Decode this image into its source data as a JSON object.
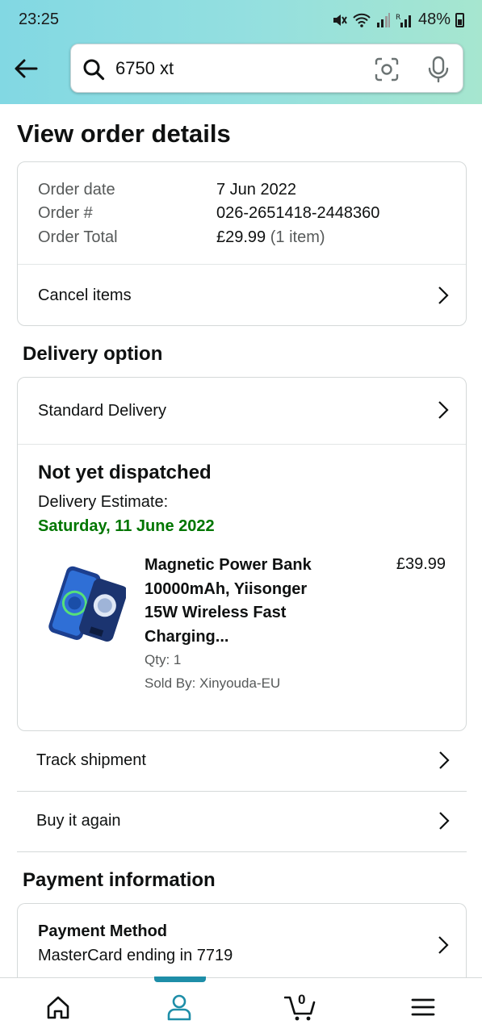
{
  "status_bar": {
    "time": "23:25",
    "battery": "48%"
  },
  "search": {
    "query": "6750 xt"
  },
  "page_title": "View order details",
  "order": {
    "date_label": "Order date",
    "date_value": "7 Jun 2022",
    "number_label": "Order #",
    "number_value": "026-2651418-2448360",
    "total_label": "Order Total",
    "total_value": "£29.99",
    "total_items": "(1 item)",
    "cancel_label": "Cancel items"
  },
  "delivery": {
    "section_title": "Delivery option",
    "option": "Standard Delivery",
    "status": "Not yet dispatched",
    "estimate_label": "Delivery Estimate:",
    "estimate_date": "Saturday, 11 June 2022"
  },
  "product": {
    "name": "Magnetic Power Bank 10000mAh, Yiisonger 15W Wireless Fast Charging...",
    "price": "£39.99",
    "qty": "Qty: 1",
    "seller": "Sold By: Xinyouda-EU"
  },
  "actions": {
    "track": "Track shipment",
    "buy_again": "Buy it again"
  },
  "payment": {
    "section_title": "Payment information",
    "method_title": "Payment Method",
    "method_value": "MasterCard ending in 7719"
  },
  "bottom_nav": {
    "cart_count": "0",
    "active_tab": "account"
  },
  "colors": {
    "accent_green": "#007600",
    "nav_indicator": "#1e8ea8"
  }
}
